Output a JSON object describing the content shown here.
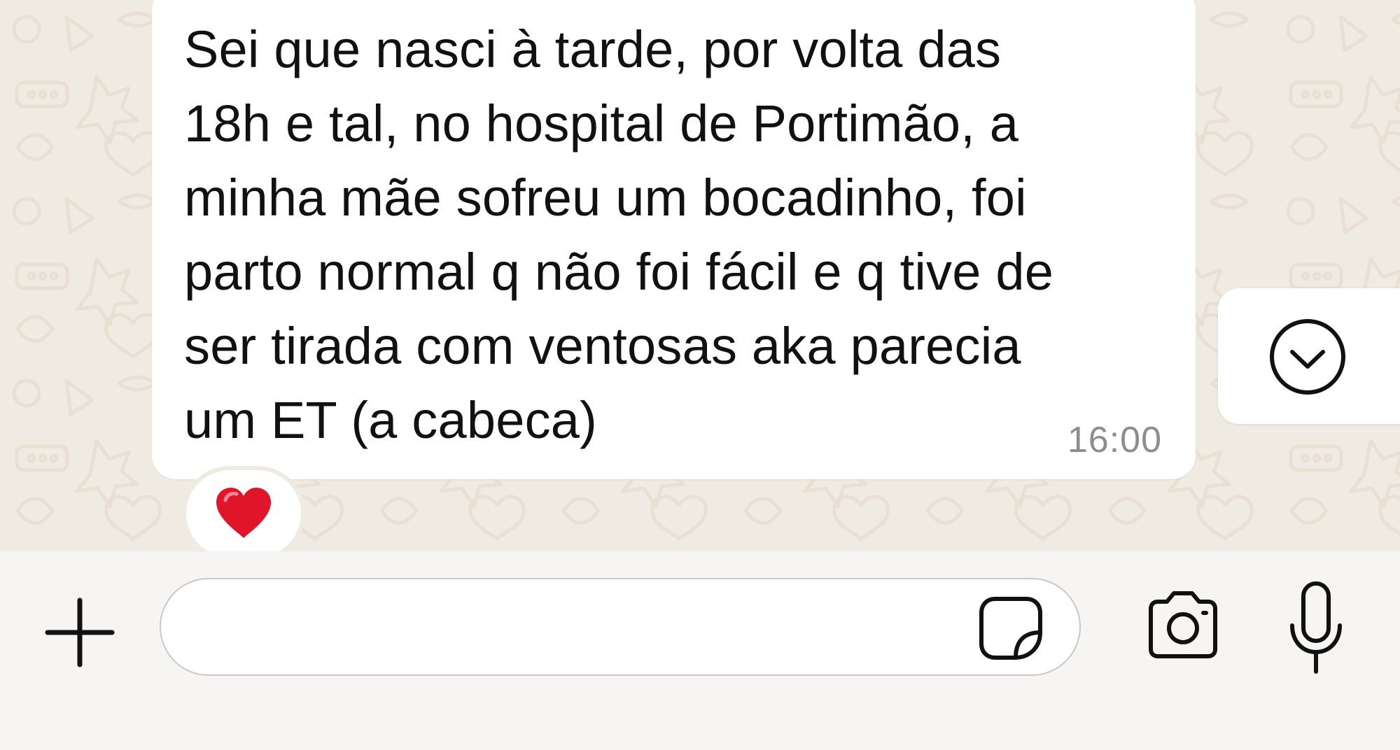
{
  "message": {
    "text": "Sei que nasci à tarde, por volta das\n18h e tal, no hospital de Portimão, a\nminha mãe sofreu um bocadinho, foi\nparto normal q não foi fácil e q tive de\nser tirada com ventosas aka parecia\num ET (a cabeca)",
    "time": "16:00",
    "reaction_icon": "red-heart-icon"
  },
  "scroll_button": {
    "icon": "chevron-down-circle-icon"
  },
  "composer": {
    "input_value": "",
    "input_placeholder": "",
    "icons": {
      "attach": "plus-icon",
      "sticker": "sticker-icon",
      "camera": "camera-icon",
      "microphone": "microphone-icon"
    }
  },
  "colors": {
    "chat_background": "#efeae2",
    "bubble_background": "#ffffff",
    "bottom_bar_background": "#f6f5f3",
    "text": "#111111",
    "timestamp": "#8d8d8d",
    "icon_stroke": "#111111",
    "heart": "#e0152a"
  }
}
